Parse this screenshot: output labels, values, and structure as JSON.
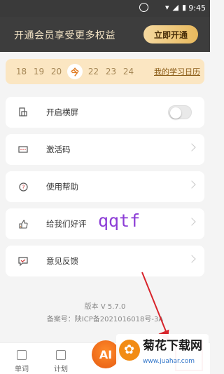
{
  "status_bar": {
    "time": "9:45"
  },
  "banner": {
    "text": "开通会员享受更多权益",
    "button_label": "立即开通"
  },
  "calendar": {
    "days": [
      "18",
      "19",
      "20",
      "今",
      "22",
      "23",
      "24"
    ],
    "link_label": "我的学习日历"
  },
  "menu": [
    {
      "label": "开启横屏",
      "icon": "screen-rotate-icon",
      "type": "toggle"
    },
    {
      "label": "激活码",
      "icon": "keycode-icon",
      "type": "link"
    },
    {
      "label": "使用帮助",
      "icon": "help-icon",
      "type": "link"
    },
    {
      "label": "给我们好评",
      "icon": "thumbs-up-icon",
      "type": "link"
    },
    {
      "label": "意见反馈",
      "icon": "feedback-icon",
      "type": "link"
    }
  ],
  "overlay_text": "qqtf",
  "footer": {
    "version": "版本 V 5.7.0",
    "icp": "备案号：陕ICP备2021016018号-3A"
  },
  "tabbar": {
    "tabs": [
      {
        "label": "单词"
      },
      {
        "label": "计划"
      }
    ],
    "ai_label": "AI"
  },
  "watermark": {
    "title": "菊花下载网",
    "url": "www.juahar.com"
  },
  "colors": {
    "accent": "#e8b95d",
    "banner_bg": "#3d3d3d",
    "calendar_bg": "#fbe6c2",
    "annotation": "#d8232a"
  }
}
